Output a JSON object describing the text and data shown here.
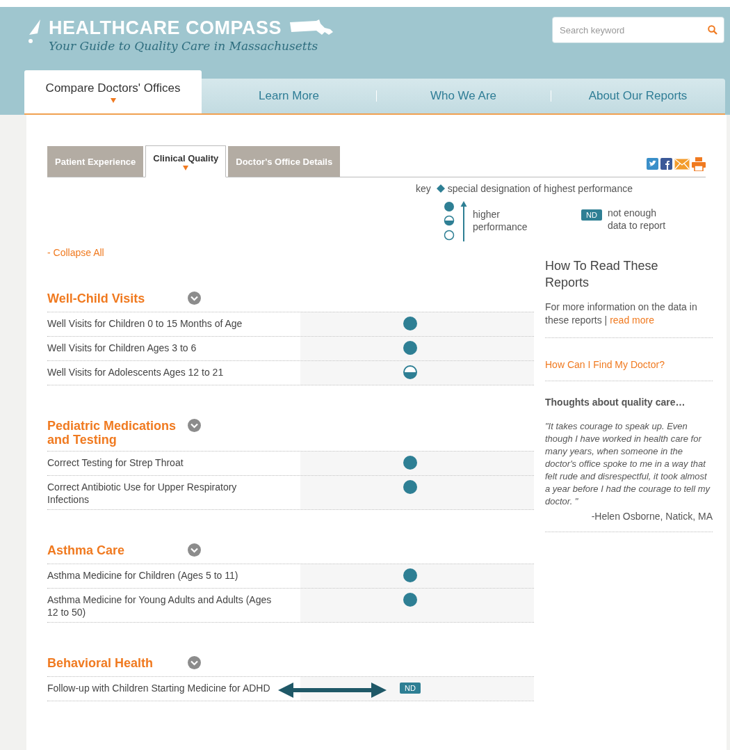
{
  "header": {
    "title": "HEALTHCARE COMPASS",
    "tagline": "Your Guide to Quality Care in Massachusetts",
    "search": {
      "placeholder": "Search keyword"
    }
  },
  "nav": [
    {
      "label": "Compare Doctors' Offices",
      "selected": true
    },
    {
      "label": "Learn More",
      "selected": false
    },
    {
      "label": "Who We Are",
      "selected": false
    },
    {
      "label": "About Our Reports",
      "selected": false
    }
  ],
  "tabs": [
    {
      "label": "Patient Experience",
      "selected": false
    },
    {
      "label": "Clinical Quality",
      "selected": true
    },
    {
      "label": "Doctor's Office Details",
      "selected": false
    }
  ],
  "key": {
    "label": "key",
    "special": "special designation of highest performance",
    "higher": "higher performance",
    "nd_badge": "ND",
    "nd_text": "not enough data to report"
  },
  "collapse": "- Collapse All",
  "sections": [
    {
      "title": "Well-Child Visits",
      "rows": [
        {
          "label": "Well Visits for Children 0 to 15 Months of Age",
          "kind": "full"
        },
        {
          "label": "Well Visits for Children Ages 3 to 6",
          "kind": "full"
        },
        {
          "label": "Well Visits for Adolescents Ages 12 to 21",
          "kind": "half"
        }
      ]
    },
    {
      "title": "Pediatric Medications and Testing",
      "rows": [
        {
          "label": "Correct Testing for Strep Throat",
          "kind": "full"
        },
        {
          "label": "Correct Antibiotic Use for Upper Respiratory Infections",
          "kind": "full"
        }
      ]
    },
    {
      "title": "Asthma Care",
      "rows": [
        {
          "label": "Asthma Medicine for Children (Ages 5 to 11)",
          "kind": "full"
        },
        {
          "label": "Asthma Medicine for Young Adults and Adults (Ages 12 to 50)",
          "kind": "full"
        }
      ]
    },
    {
      "title": "Behavioral Health",
      "rows": [
        {
          "label": "Follow-up with Children Starting Medicine for ADHD",
          "kind": "nd",
          "nd_label": "ND"
        }
      ]
    }
  ],
  "sidebar": {
    "title": "How To Read These Reports",
    "info": "For more information on the data in these reports |",
    "read_more": "read more",
    "find_link": "How Can I Find My Doctor?",
    "thoughts_title": "Thoughts about quality care…",
    "quote": "\"It takes courage to speak up. Even though I have worked in health care for many years, when someone in the doctor's office spoke to me in a way that felt rude and disrespectful, it took almost a year before I had the courage to tell my doctor. \"",
    "attribution": "-Helen Osborne, Natick, MA"
  }
}
